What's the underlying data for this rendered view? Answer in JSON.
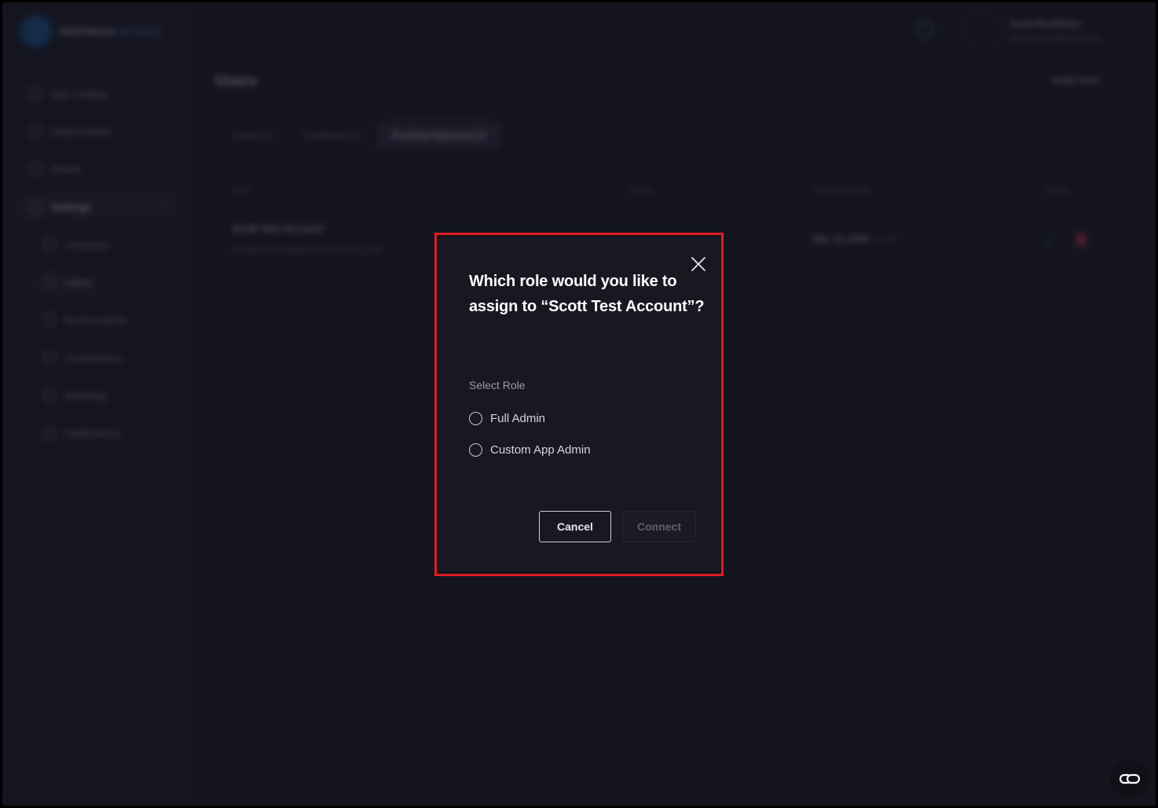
{
  "app": {
    "logo_text_primary": "PANTHEON",
    "logo_text_secondary": "ACCESS"
  },
  "sidebar": {
    "items": [
      {
        "label": "App Catalog"
      },
      {
        "label": "Deployments"
      },
      {
        "label": "Assets"
      },
      {
        "label": "Settings"
      },
      {
        "label": "Company"
      },
      {
        "label": "Users"
      },
      {
        "label": "Environments"
      },
      {
        "label": "Connections"
      },
      {
        "label": "Branding"
      },
      {
        "label": "Notifications"
      }
    ]
  },
  "header": {
    "user_name": "Scott McAllister",
    "user_org": "Scott's Sandbox Tenant"
  },
  "page": {
    "title": "Users",
    "invite_label": "Invite User",
    "tabs": [
      {
        "label": "Active (1)"
      },
      {
        "label": "Invitations (1)"
      },
      {
        "label": "Pending Approval (1)"
      }
    ],
    "columns": [
      "User",
      "Roles",
      "Received Date",
      "Action"
    ],
    "row": {
      "name": "Scott Test Account",
      "email": "scottgas+00test@pantheonaccess.com",
      "date": "Mar 13, 2024",
      "time": "11:14"
    }
  },
  "modal": {
    "title": "Which role would you like to assign to “Scott Test Account”?",
    "select_label": "Select Role",
    "options": [
      {
        "label": "Full Admin",
        "selected": false
      },
      {
        "label": "Custom App Admin",
        "selected": false
      }
    ],
    "cancel_label": "Cancel",
    "connect_label": "Connect",
    "highlight_color": "#e01b24"
  },
  "icons": {
    "close": "close-icon",
    "chat": "chat-icon"
  }
}
